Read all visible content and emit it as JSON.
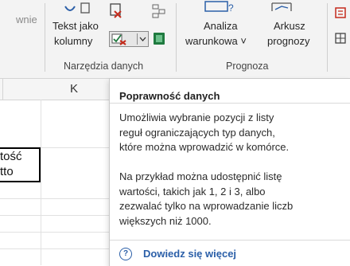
{
  "ribbon": {
    "left_partial_label": "wnie",
    "text_to_columns": {
      "line1": "Tekst jako",
      "line2": "kolumny"
    },
    "data_tools_group": "Narzędzia danych",
    "what_if": {
      "line1": "Analiza",
      "line2": "warunkowa ˅"
    },
    "forecast_sheet": {
      "line1": "Arkusz",
      "line2": "prognozy"
    },
    "forecast_group": "Prognoza"
  },
  "sheet": {
    "column_k": "K",
    "cell_partial_1": "tość",
    "cell_partial_2": "tto"
  },
  "tooltip": {
    "title": "Poprawność danych",
    "para1": "Umożliwia wybranie pozycji z listy\nreguł ograniczających typ danych,\nktóre można wprowadzić w komórce.",
    "para2": "Na przykład można udostępnić listę\nwartości, takich jak 1, 2 i 3, albo\nzezwalać tylko na wprowadzanie liczb\nwiększych niż 1000.",
    "help_icon": "?",
    "help_link": "Dowiedz się więcej"
  },
  "colors": {
    "accent_link": "#2b5fa8",
    "excel_green": "#1f7a3f",
    "red_icon": "#c42b1c"
  }
}
